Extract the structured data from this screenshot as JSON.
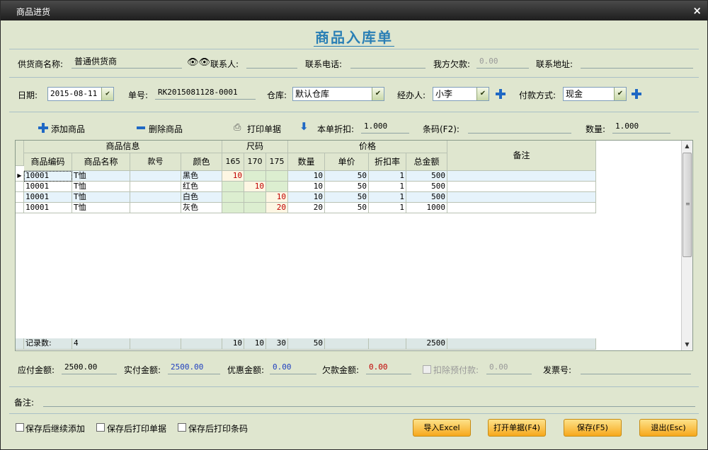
{
  "window": {
    "title": "商品进货",
    "close": "×"
  },
  "doc_title": "商品入库单",
  "header": {
    "supplier_label": "供货商名称:",
    "supplier_value": "普通供货商",
    "contact_label": "联系人:",
    "contact_value": "",
    "phone_label": "联系电话:",
    "phone_value": "",
    "debt_label": "我方欠款:",
    "debt_value": "0.00",
    "address_label": "联系地址:",
    "address_value": "",
    "date_label": "日期:",
    "date_value": "2015-08-11",
    "no_label": "单号:",
    "no_value": "RK2015081128-0001",
    "warehouse_label": "仓库:",
    "warehouse_value": "默认仓库",
    "handler_label": "经办人:",
    "handler_value": "小李",
    "payment_label": "付款方式:",
    "payment_value": "现金"
  },
  "toolbar": {
    "add_label": "添加商品",
    "delete_label": "删除商品",
    "print_label": "打印单据",
    "discount_label": "本单折扣:",
    "discount_value": "1.000",
    "barcode_label": "条码(F2):",
    "barcode_value": "",
    "qty_label": "数量:",
    "qty_value": "1.000"
  },
  "grid": {
    "groups": {
      "info": "商品信息",
      "size": "尺码",
      "price": "价格",
      "note": "备注"
    },
    "columns": {
      "code": "商品编码",
      "name": "商品名称",
      "style": "款号",
      "color": "颜色",
      "s165": "165",
      "s170": "170",
      "s175": "175",
      "qty": "数量",
      "unit": "单价",
      "rate": "折扣率",
      "total": "总金额"
    },
    "rows": [
      {
        "code": "10001",
        "name": "T恤",
        "style": "",
        "color": "黑色",
        "s165": "10",
        "s170": "",
        "s175": "",
        "qty": "10",
        "unit": "50",
        "rate": "1",
        "total": "500",
        "note": ""
      },
      {
        "code": "10001",
        "name": "T恤",
        "style": "",
        "color": "红色",
        "s165": "",
        "s170": "10",
        "s175": "",
        "qty": "10",
        "unit": "50",
        "rate": "1",
        "total": "500",
        "note": ""
      },
      {
        "code": "10001",
        "name": "T恤",
        "style": "",
        "color": "白色",
        "s165": "",
        "s170": "",
        "s175": "10",
        "qty": "10",
        "unit": "50",
        "rate": "1",
        "total": "500",
        "note": ""
      },
      {
        "code": "10001",
        "name": "T恤",
        "style": "",
        "color": "灰色",
        "s165": "",
        "s170": "",
        "s175": "20",
        "qty": "20",
        "unit": "50",
        "rate": "1",
        "total": "1000",
        "note": ""
      }
    ],
    "footer": {
      "label": "记录数:",
      "count": "4",
      "s165": "10",
      "s170": "10",
      "s175": "30",
      "qty": "50",
      "total": "2500"
    }
  },
  "summary": {
    "payable_label": "应付金额:",
    "payable_value": "2500.00",
    "paid_label": "实付金额:",
    "paid_value": "2500.00",
    "discount_label": "优惠金额:",
    "discount_value": "0.00",
    "owed_label": "欠款金额:",
    "owed_value": "0.00",
    "deduct_label": "扣除预付款:",
    "deduct_value": "0.00",
    "invoice_label": "发票号:",
    "invoice_value": ""
  },
  "remark": {
    "label": "备注:",
    "value": ""
  },
  "options": {
    "continue_add": "保存后继续添加",
    "print_doc": "保存后打印单据",
    "print_barcode": "保存后打印条码"
  },
  "buttons": {
    "import_excel": "导入Excel",
    "open_doc": "打开单据(F4)",
    "save": "保存(F5)",
    "exit": "退出(Esc)"
  },
  "colors": {
    "panel": "#dfe6cf",
    "title_blue": "#2a7fb5",
    "button_orange": "#f7a81c",
    "paid_blue": "#1f3fbf",
    "owed_red": "#c00000"
  }
}
